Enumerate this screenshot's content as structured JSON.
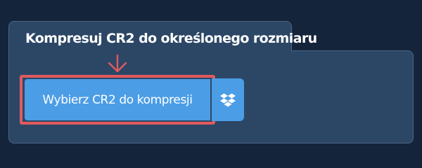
{
  "tool": {
    "title": "Kompresuj CR2 do określonego rozmiaru"
  },
  "upload": {
    "select_button_label": "Wybierz CR2 do kompresji",
    "dropbox_icon": "dropbox-icon",
    "pointer_icon": "arrow-down-icon"
  },
  "colors": {
    "page_background": "#14243a",
    "panel_background": "#2c4766",
    "button_blue": "#4b9de6",
    "highlight_red": "#e05a5e"
  }
}
